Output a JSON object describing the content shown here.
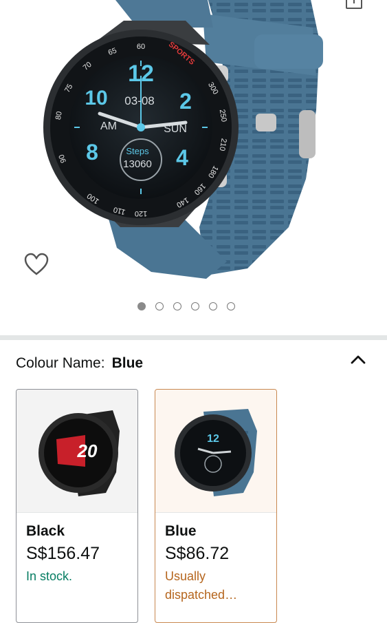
{
  "hero": {
    "watch_face": {
      "hour_12": "12",
      "hour_2": "2",
      "hour_4": "4",
      "hour_8": "8",
      "hour_10": "10",
      "date": "03-08",
      "am": "AM",
      "day": "SUN",
      "steps_label": "Steps",
      "steps_value": "13060",
      "sports": "SPORTS",
      "bezel": [
        "60",
        "65",
        "70",
        "75",
        "80",
        "90",
        "100",
        "110",
        "120",
        "140",
        "160",
        "180",
        "210",
        "250",
        "300"
      ]
    },
    "carousel": {
      "count": 6,
      "active_index": 0
    }
  },
  "variant": {
    "label": "Colour Name:",
    "selected_value": "Blue"
  },
  "options": [
    {
      "name": "Black",
      "price": "S$156.47",
      "availability": "In stock.",
      "face_number": "20"
    },
    {
      "name": "Blue",
      "price": "S$86.72",
      "availability": "Usually dispatched…",
      "face_number": "12"
    }
  ],
  "colors": {
    "strap_blue": "#4a7593",
    "strap_black": "#222222",
    "accent_cyan": "#5cc8e8",
    "in_stock_green": "#067d62",
    "dispatch_orange": "#b5651d",
    "selected_border": "#c8874f"
  },
  "icons": {
    "share": "share-icon",
    "wishlist": "heart-outline-icon",
    "collapse": "chevron-up-icon"
  }
}
